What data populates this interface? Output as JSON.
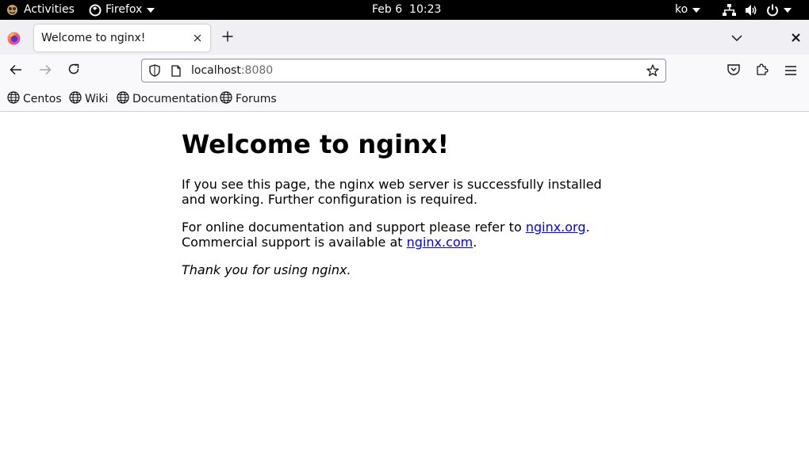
{
  "topbar": {
    "activities": "Activities",
    "app_name": "Firefox",
    "datetime": "Feb 6  10:23",
    "input_method": "ko"
  },
  "tabs": [
    {
      "title": "Welcome to nginx!"
    }
  ],
  "urlbar": {
    "host": "localhost",
    "port": ":8080"
  },
  "bookmarks": [
    {
      "label": "Centos"
    },
    {
      "label": "Wiki"
    },
    {
      "label": "Documentation"
    },
    {
      "label": "Forums"
    }
  ],
  "page": {
    "heading": "Welcome to nginx!",
    "para1": "If you see this page, the nginx web server is successfully installed and working. Further configuration is required.",
    "para2_prefix": "For online documentation and support please refer to ",
    "link1": "nginx.org",
    "para2_mid": ".",
    "para2_line2": "Commercial support is available at ",
    "link2": "nginx.com",
    "para2_end": ".",
    "thanks": "Thank you for using nginx."
  },
  "colors": {
    "link": "#0000ee",
    "chrome_bg": "#f0f0f4",
    "toolbar_bg": "#f9f9fb"
  }
}
